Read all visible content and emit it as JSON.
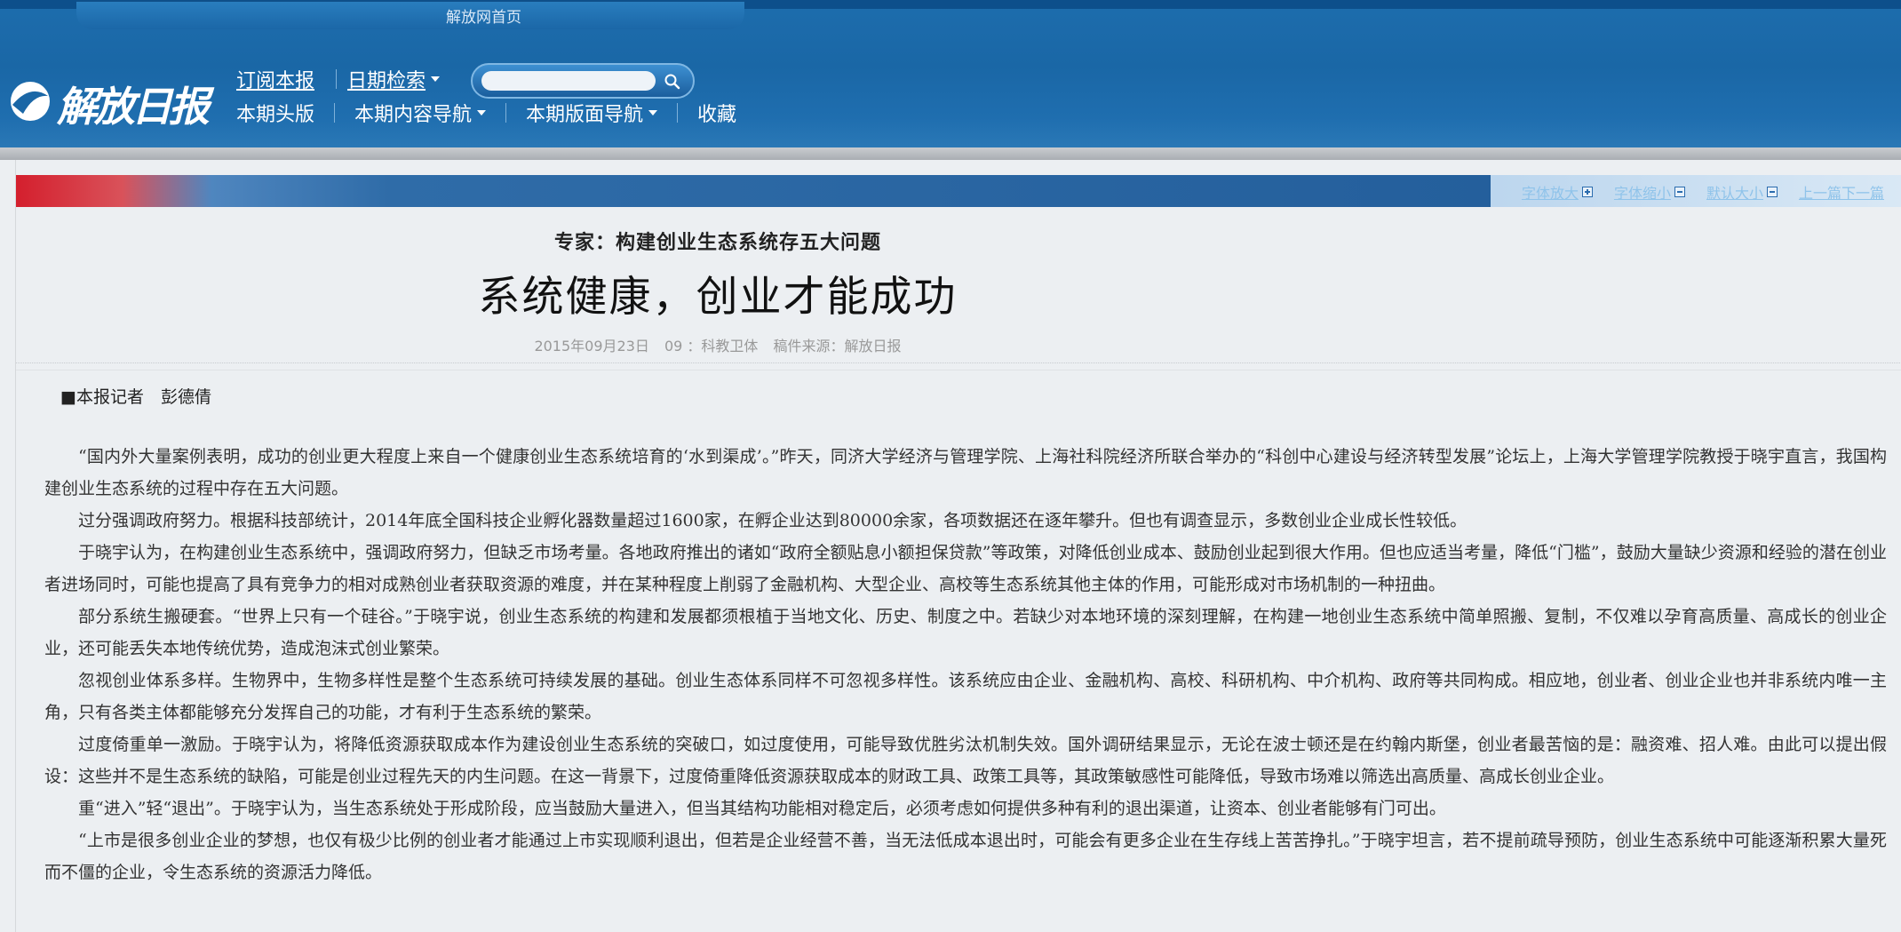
{
  "header": {
    "home_link": "解放网首页",
    "logo_text": "解放日报",
    "nav_row1": [
      {
        "label": "订阅本报",
        "dropdown": false
      },
      {
        "label": "日期检索",
        "dropdown": true
      }
    ],
    "nav_row2": [
      {
        "label": "本期头版",
        "dropdown": false
      },
      {
        "label": "本期内容导航",
        "dropdown": true
      },
      {
        "label": "本期版面导航",
        "dropdown": true
      },
      {
        "label": "收藏",
        "dropdown": false
      }
    ],
    "search_placeholder": ""
  },
  "toolbar": {
    "font_up": "字体放大",
    "font_down": "字体缩小",
    "font_default": "默认大小",
    "prev_next": "上一篇下一篇"
  },
  "article": {
    "subtitle": "专家：构建创业生态系统存五大问题",
    "title": "系统健康，创业才能成功",
    "date": "2015年09月23日",
    "page": "09 ：科教卫体",
    "source": "稿件来源：解放日报",
    "byline": "■本报记者　彭德倩",
    "paragraphs": [
      "“国内外大量案例表明，成功的创业更大程度上来自一个健康创业生态系统培育的‘水到渠成’。”昨天，同济大学经济与管理学院、上海社科院经济所联合举办的“科创中心建设与经济转型发展”论坛上，上海大学管理学院教授于晓宇直言，我国构建创业生态系统的过程中存在五大问题。",
      "过分强调政府努力。根据科技部统计，2014年底全国科技企业孵化器数量超过1600家，在孵企业达到80000余家，各项数据还在逐年攀升。但也有调查显示，多数创业企业成长性较低。",
      "于晓宇认为，在构建创业生态系统中，强调政府努力，但缺乏市场考量。各地政府推出的诸如“政府全额贴息小额担保贷款”等政策，对降低创业成本、鼓励创业起到很大作用。但也应适当考量，降低“门槛”，鼓励大量缺少资源和经验的潜在创业者进场同时，可能也提高了具有竞争力的相对成熟创业者获取资源的难度，并在某种程度上削弱了金融机构、大型企业、高校等生态系统其他主体的作用，可能形成对市场机制的一种扭曲。",
      "部分系统生搬硬套。“世界上只有一个硅谷。”于晓宇说，创业生态系统的构建和发展都须根植于当地文化、历史、制度之中。若缺少对本地环境的深刻理解，在构建一地创业生态系统中简单照搬、复制，不仅难以孕育高质量、高成长的创业企业，还可能丢失本地传统优势，造成泡沫式创业繁荣。",
      "忽视创业体系多样。生物界中，生物多样性是整个生态系统可持续发展的基础。创业生态体系同样不可忽视多样性。该系统应由企业、金融机构、高校、科研机构、中介机构、政府等共同构成。相应地，创业者、创业企业也并非系统内唯一主角，只有各类主体都能够充分发挥自己的功能，才有利于生态系统的繁荣。",
      "过度倚重单一激励。于晓宇认为，将降低资源获取成本作为建设创业生态系统的突破口，如过度使用，可能导致优胜劣汰机制失效。国外调研结果显示，无论在波士顿还是在约翰内斯堡，创业者最苦恼的是：融资难、招人难。由此可以提出假设：这些并不是生态系统的缺陷，可能是创业过程先天的内生问题。在这一背景下，过度倚重降低资源获取成本的财政工具、政策工具等，其政策敏感性可能降低，导致市场难以筛选出高质量、高成长创业企业。",
      "重“进入”轻“退出”。于晓宇认为，当生态系统处于形成阶段，应当鼓励大量进入，但当其结构功能相对稳定后，必须考虑如何提供多种有利的退出渠道，让资本、创业者能够有门可出。",
      "“上市是很多创业企业的梦想，也仅有极少比例的创业者才能通过上市实现顺利退出，但若是企业经营不善，当无法低成本退出时，可能会有更多企业在生存线上苦苦挣扎。”于晓宇坦言，若不提前疏导预防，创业生态系统中可能逐渐积累大量死而不僵的企业，令生态系统的资源活力降低。"
    ]
  }
}
